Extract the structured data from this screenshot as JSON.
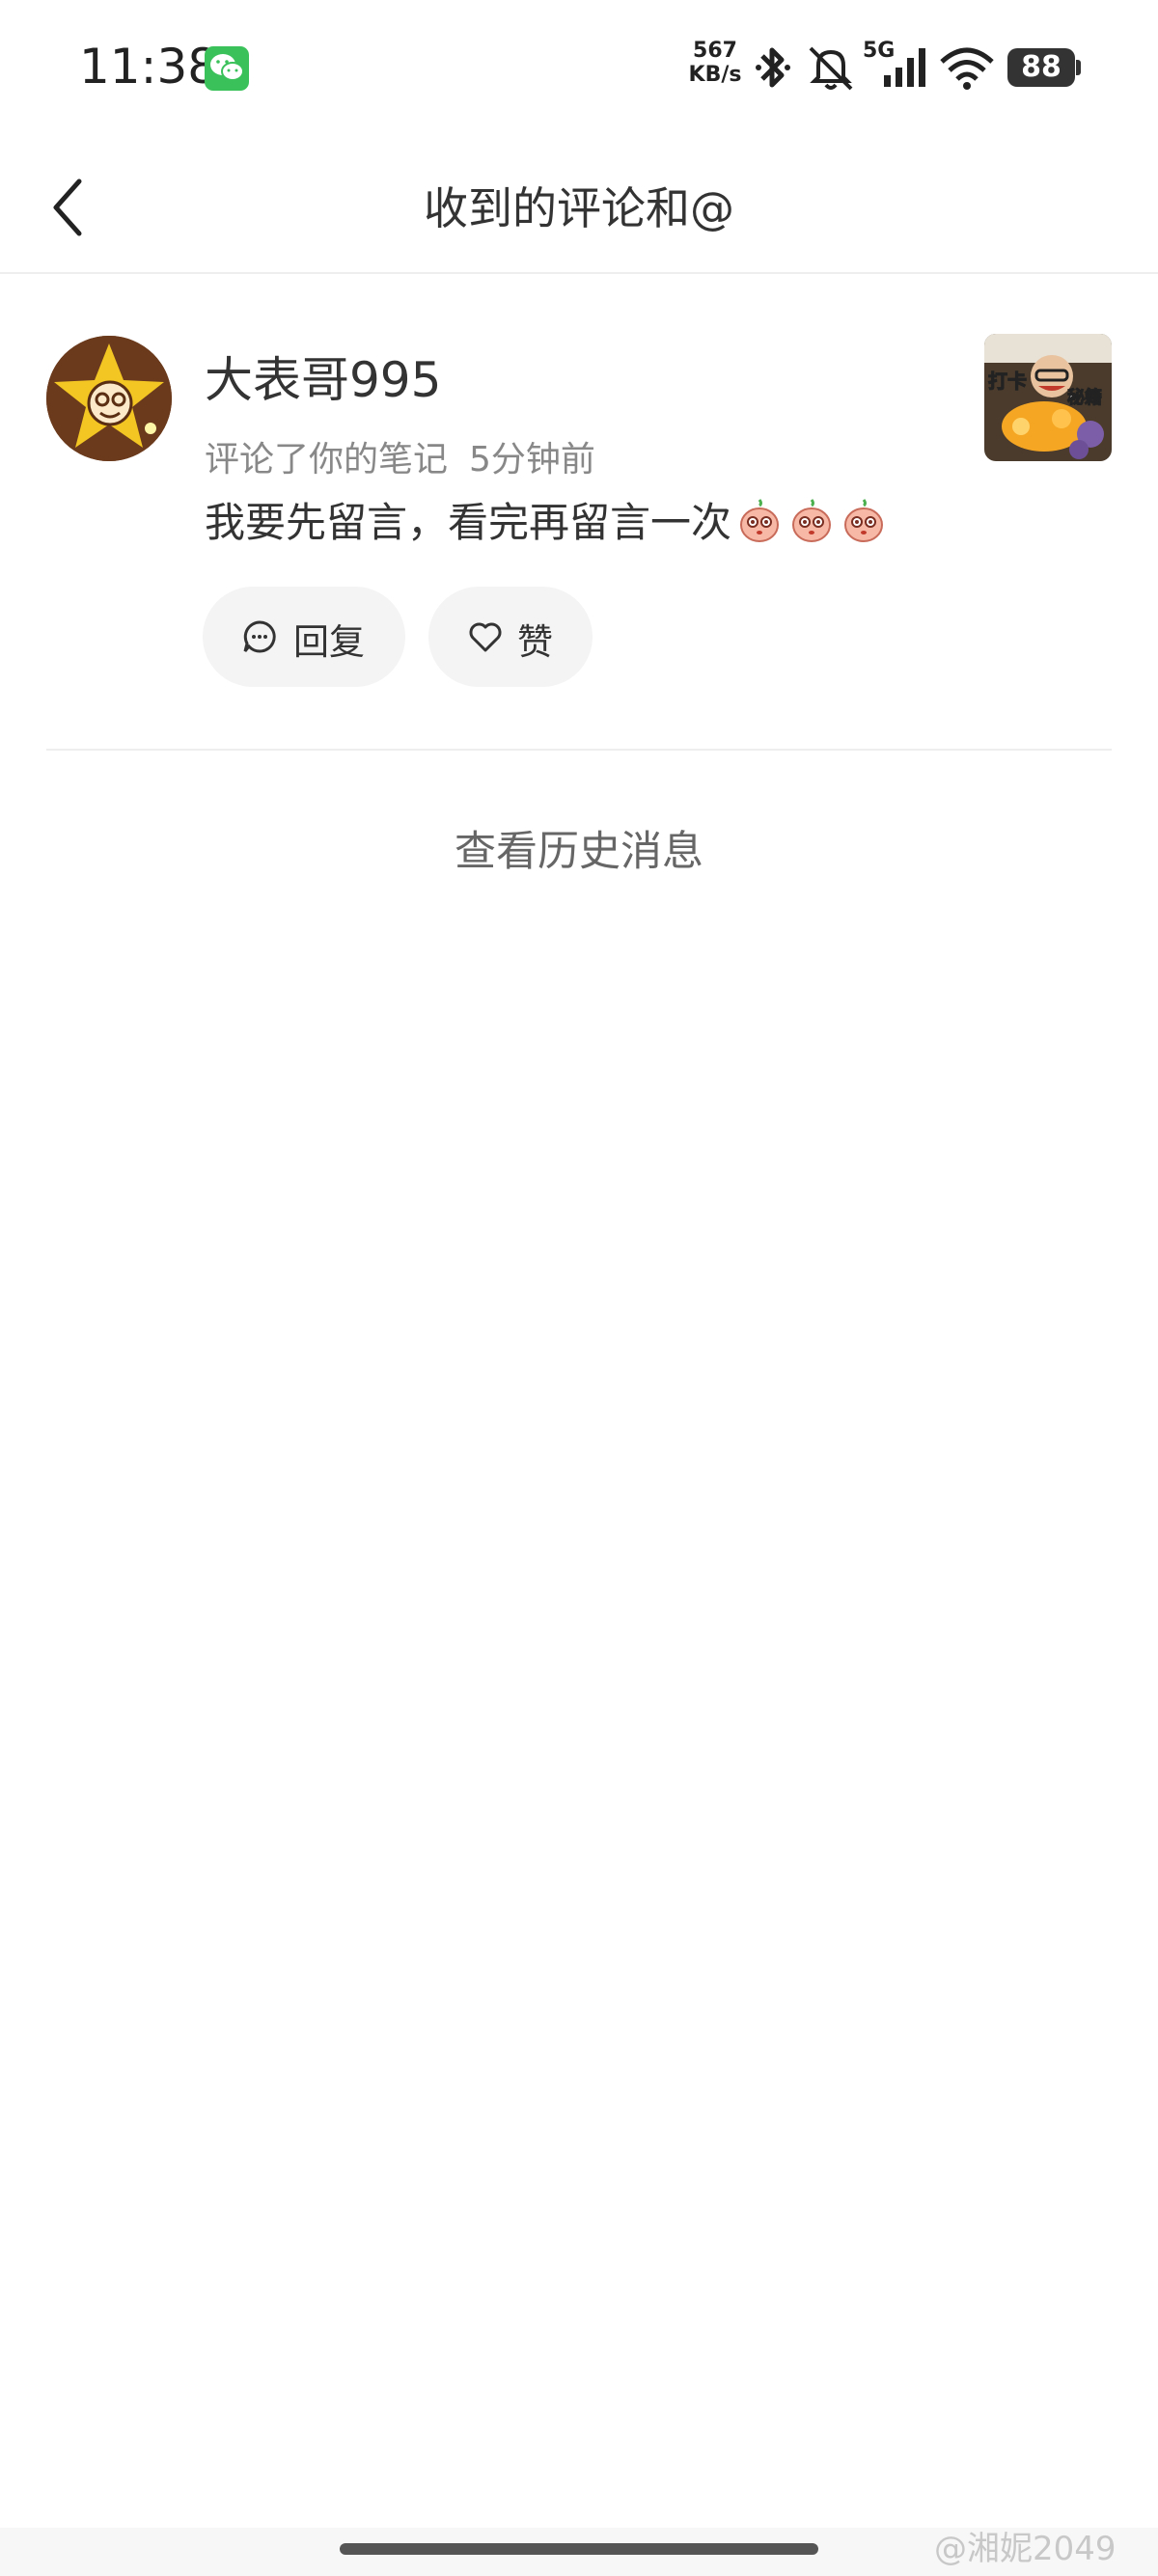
{
  "status_bar": {
    "time": "11:38",
    "net_speed_value": "567",
    "net_speed_unit": "KB/s",
    "network": "5G",
    "battery": "88",
    "icons": [
      "wechat-icon",
      "bluetooth-icon",
      "mute-bell-icon",
      "signal-icon",
      "wifi-icon",
      "battery-icon"
    ]
  },
  "header": {
    "title": "收到的评论和@",
    "back_icon": "chevron-left-icon"
  },
  "notification": {
    "username": "大表哥995",
    "action": "评论了你的笔记",
    "time_ago": "5分钟前",
    "comment_text": "我要先留言，看完再留言一次",
    "emoji_count": 3,
    "thumbnail_text_left": "打卡",
    "thumbnail_text_right": "秘籍",
    "reply_label": "回复",
    "like_label": "赞"
  },
  "history_label": "查看历史消息",
  "watermark": "@湘妮2049",
  "colors": {
    "accent_wechat": "#3ac15a",
    "text_primary": "#333333",
    "text_secondary": "#888888",
    "pill_bg": "#f4f4f4"
  }
}
